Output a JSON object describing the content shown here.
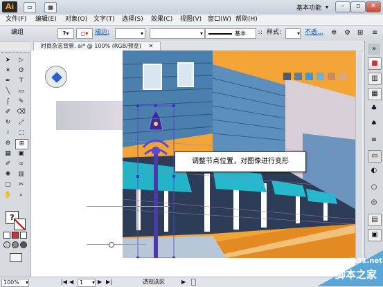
{
  "app": {
    "logo": "Ai",
    "workspace": "基本功能",
    "window_buttons": [
      "–",
      "▫",
      "✕"
    ]
  },
  "menu": [
    "文件(F)",
    "编辑(E)",
    "对象(O)",
    "文字(T)",
    "选择(S)",
    "效果(C)",
    "视图(V)",
    "窗口(W)",
    "帮助(H)"
  ],
  "control": {
    "selection_label": "编组",
    "stroke_label": "描边:",
    "stroke_style": "基本",
    "style_label": "样式:",
    "opacity_label": "不透..."
  },
  "document": {
    "tab_title": "时尚杂志背景. ai* @ 100% (RGB/预览)"
  },
  "callout": {
    "text": "调整节点位置，对图像进行变形"
  },
  "status": {
    "zoom": "100%",
    "page": "1",
    "tool_name": "透视选区"
  },
  "watermark": {
    "domain": "jb51.net",
    "name": "脚本之家"
  },
  "swatches": [
    "#4a5e7a",
    "#5b7ea6",
    "#3d9ad8",
    "#6fb0d8",
    "#c98a6a",
    "#d8a48a"
  ],
  "icons": {
    "tools": [
      "selection-icon",
      "direct-selection-icon",
      "magic-wand-icon",
      "lasso-icon",
      "pen-icon",
      "type-icon",
      "line-icon",
      "rectangle-icon",
      "paintbrush-icon",
      "pencil-icon",
      "blob-brush-icon",
      "eraser-icon",
      "rotate-icon",
      "scale-icon",
      "width-icon",
      "free-transform-icon",
      "shape-builder-icon",
      "perspective-grid-icon",
      "mesh-icon",
      "gradient-icon",
      "eyedropper-icon",
      "blend-icon",
      "symbol-sprayer-icon",
      "column-graph-icon",
      "artboard-icon",
      "slice-icon",
      "hand-icon",
      "zoom-icon"
    ]
  }
}
